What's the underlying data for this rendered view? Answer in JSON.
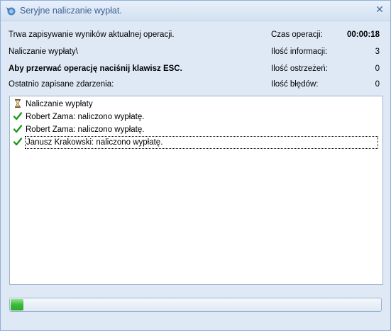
{
  "window": {
    "title": "Seryjne naliczanie wypłat.",
    "close_symbol": "✕"
  },
  "status": {
    "operation_text": "Trwa zapisywanie wyników aktualnej operacji.",
    "current_step": "Naliczanie wypłaty\\",
    "esc_hint": "Aby przerwać operację naciśnij klawisz ESC.",
    "last_saved_label": "Ostatnio zapisane zdarzenia:"
  },
  "stats": {
    "time_label": "Czas operacji:",
    "time_value": "00:00:18",
    "info_label": "Ilość informacji:",
    "info_value": "3",
    "warnings_label": "Ilość ostrzeżeń:",
    "warnings_value": "0",
    "errors_label": "Ilość błędów:",
    "errors_value": "0"
  },
  "log": [
    {
      "icon": "hourglass-icon",
      "text": "Naliczanie wypłaty"
    },
    {
      "icon": "checkmark-icon",
      "text": "Robert Zama: naliczono wypłatę."
    },
    {
      "icon": "checkmark-icon",
      "text": "Robert Zama: naliczono wypłatę."
    },
    {
      "icon": "checkmark-icon",
      "text": "Janusz Krakowski: naliczono wypłatę."
    }
  ],
  "progress": {
    "fraction": 0.035
  },
  "colors": {
    "title": "#3b5f93",
    "progress_green": "#3cb93a",
    "check_green": "#1f9a1c"
  }
}
